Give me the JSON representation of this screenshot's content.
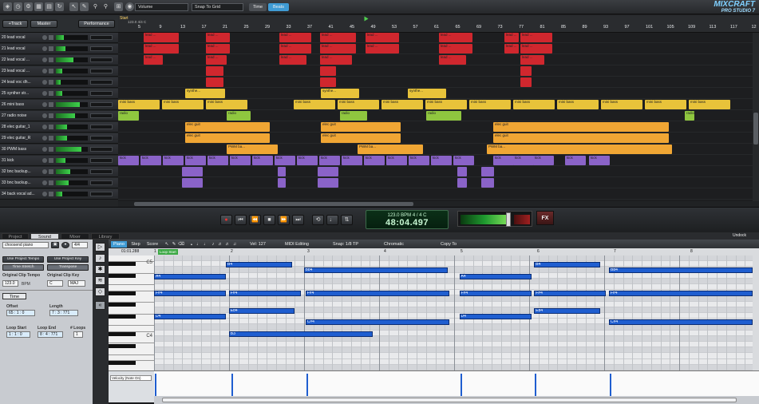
{
  "toolbar": {
    "param_dropdown": "Volume",
    "snap_dropdown": "Snap To Grid",
    "time_btn": "Time",
    "beats_btn": "Beats",
    "logo_main": "MIXCRAFT",
    "logo_sub": "PRO STUDIO 7",
    "logo_num": "7"
  },
  "trackheader": {
    "add_track": "+Track",
    "master": "Master",
    "performance": "Performance"
  },
  "ruler": {
    "start_label": "Start",
    "tempo_label": "123.0 4/4 C",
    "ticks": [
      "5",
      "9",
      "13",
      "17",
      "21",
      "25",
      "29",
      "33",
      "37",
      "41",
      "45",
      "49",
      "53",
      "57",
      "61",
      "65",
      "69",
      "73",
      "77",
      "81",
      "85",
      "89",
      "93",
      "97",
      "101",
      "105",
      "109",
      "113",
      "117",
      "12"
    ]
  },
  "tracks": [
    {
      "name": "20 lead vocal",
      "level": 0.25
    },
    {
      "name": "21 lead vocal",
      "level": 0.3
    },
    {
      "name": "22 lead vocal ...",
      "level": 0.55
    },
    {
      "name": "23 lead vocal ...",
      "level": 0.2
    },
    {
      "name": "24 lead voc dh...",
      "level": 0.15
    },
    {
      "name": "25 synther str...",
      "level": 0.2
    },
    {
      "name": "26 mini bass",
      "level": 0.75
    },
    {
      "name": "27 radio noise",
      "level": 0.6
    },
    {
      "name": "28 elec guitar_1",
      "level": 0.35
    },
    {
      "name": "29 elec guitar_R",
      "level": 0.35
    },
    {
      "name": "30 PWM bass",
      "level": 0.8
    },
    {
      "name": "31 kick",
      "level": 0.3
    },
    {
      "name": "32 bnc backup...",
      "level": 0.45
    },
    {
      "name": "33 bnc backup...",
      "level": 0.4
    },
    {
      "name": "34 back vocal ad...",
      "level": 0.2
    }
  ],
  "clips": {
    "lead": "lead ...",
    "synth": "synthe...",
    "mini_bass": "mini bass",
    "radio": "radio",
    "elec": "elec guit",
    "pwm": "PWM ba...",
    "kick": "kick"
  },
  "transport": {
    "bpm_line": "123.0 BPM  4 / 4    C",
    "time": "48:04.497",
    "fx": "FX"
  },
  "lower_tabs": {
    "project": "Project",
    "sound": "Sound",
    "mixer": "Mixer",
    "library": "Library",
    "undock": "Undock"
  },
  "left_panel": {
    "instrument": "choosend piano",
    "ratio": "4/4",
    "use_tempo": "Use Project Tempo",
    "use_key": "Use Project Key",
    "time_stretch": "Time Stretch",
    "transpose": "Transpose",
    "orig_tempo_label": "Original Clip Tempo",
    "orig_key_label": "Original Clip Key",
    "tempo_val": "123.0",
    "bpm": "BPM",
    "key_val": "C",
    "maj": "MAJ",
    "time_tab": "Time",
    "offset_label": "Offset",
    "offset_val": "65 : 1 : 0",
    "length_label": "Length",
    "length_val": "7 : 3 : 771",
    "loop_start_label": "Loop Start",
    "loop_start_val": "1 : 1 : 0",
    "loop_end_label": "Loop End",
    "loop_end_val": "8 : 4 : 771",
    "loops_label": "# Loops",
    "loops_val": "1"
  },
  "piano_toolbar": {
    "piano": "Piano",
    "step": "Step",
    "score": "Score",
    "velocity": "Vel: 127",
    "midi_editing": "MIDI Editing",
    "snap": "Snap: 1/8 TP",
    "scale": "Chromatic",
    "copy": "Copy To",
    "position": "01:01.288",
    "loop_start": "Loop Start"
  },
  "piano_ruler_marks": [
    "1",
    "2",
    "3",
    "4",
    "5",
    "6",
    "7",
    "8"
  ],
  "key_labels": {
    "c5": "C5",
    "c4": "C4"
  },
  "notes": [
    {
      "label": "B4",
      "row": 1,
      "start": 0.12,
      "len": 0.11
    },
    {
      "label": "Bb4",
      "row": 2,
      "start": 0.25,
      "len": 0.24
    },
    {
      "label": "A4",
      "row": 3,
      "start": 0.0,
      "len": 0.12
    },
    {
      "label": "A4",
      "row": 3,
      "start": 0.51,
      "len": 0.12
    },
    {
      "label": "B4",
      "row": 1,
      "start": 0.635,
      "len": 0.11
    },
    {
      "label": "Bb4",
      "row": 2,
      "start": 0.76,
      "len": 0.24
    },
    {
      "label": "F#4",
      "row": 6,
      "start": 0.0,
      "len": 0.12
    },
    {
      "label": "F#4",
      "row": 6,
      "start": 0.125,
      "len": 0.12
    },
    {
      "label": "F#4",
      "row": 6,
      "start": 0.253,
      "len": 0.24
    },
    {
      "label": "F#4",
      "row": 6,
      "start": 0.51,
      "len": 0.12
    },
    {
      "label": "F#4",
      "row": 6,
      "start": 0.635,
      "len": 0.12
    },
    {
      "label": "F#4",
      "row": 6,
      "start": 0.76,
      "len": 0.24
    },
    {
      "label": "Eb4",
      "row": 9,
      "start": 0.125,
      "len": 0.11
    },
    {
      "label": "Eb4",
      "row": 9,
      "start": 0.635,
      "len": 0.11
    },
    {
      "label": "D4",
      "row": 10,
      "start": 0.0,
      "len": 0.12
    },
    {
      "label": "D4",
      "row": 10,
      "start": 0.51,
      "len": 0.12
    },
    {
      "label": "C#4",
      "row": 11,
      "start": 0.253,
      "len": 0.24
    },
    {
      "label": "C#4",
      "row": 11,
      "start": 0.76,
      "len": 0.24
    },
    {
      "label": "B3",
      "row": 13,
      "start": 0.125,
      "len": 0.24
    }
  ],
  "velocity_label": "Velocity (Note On)",
  "velocity_bars": [
    0.0,
    0.128,
    0.253,
    0.51,
    0.635,
    0.76
  ],
  "colors": {
    "red": "#d0272e",
    "yellow": "#e8c33a",
    "orange": "#f0a634",
    "green": "#8fc63f",
    "purple": "#8a63c8",
    "note": "#1f5ed0"
  }
}
